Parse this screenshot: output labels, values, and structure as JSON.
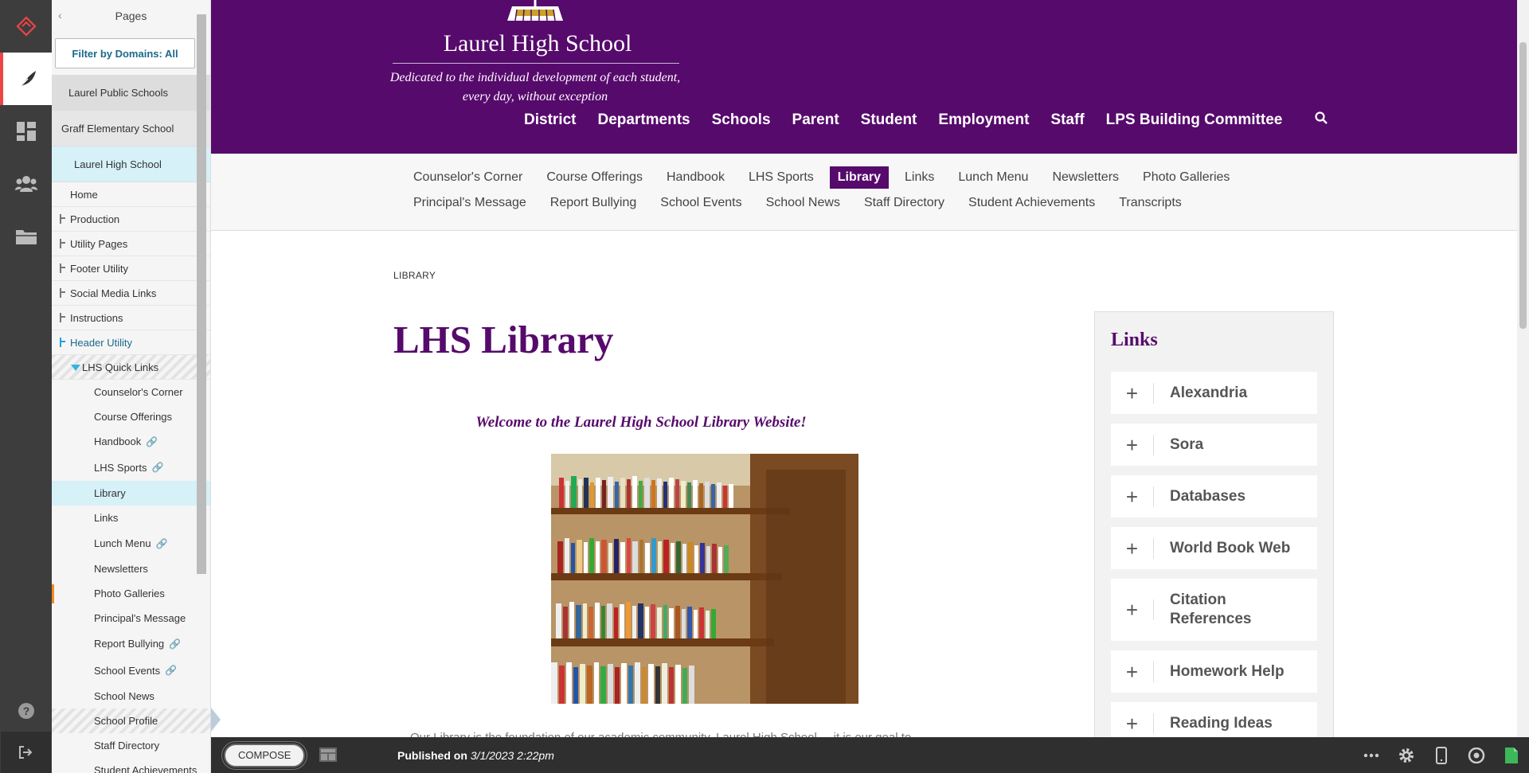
{
  "pages_panel": {
    "title": "Pages",
    "filter": "Filter by Domains: All",
    "domains": [
      "Laurel Public Schools",
      "Graff Elementary School",
      "Laurel High School"
    ],
    "tree_top": [
      {
        "label": "Home"
      },
      {
        "label": "Production"
      },
      {
        "label": "Utility Pages"
      },
      {
        "label": "Footer Utility"
      },
      {
        "label": "Social Media Links"
      },
      {
        "label": "Instructions"
      },
      {
        "label": "Header Utility"
      }
    ],
    "group": "LHS Quick Links",
    "children": [
      {
        "label": "Counselor's Corner"
      },
      {
        "label": "Course Offerings"
      },
      {
        "label": "Handbook"
      },
      {
        "label": "LHS Sports"
      },
      {
        "label": "Library"
      },
      {
        "label": "Links"
      },
      {
        "label": "Lunch Menu"
      },
      {
        "label": "Newsletters"
      },
      {
        "label": "Photo Galleries"
      },
      {
        "label": "Principal's Message"
      },
      {
        "label": "Report Bullying"
      },
      {
        "label": "School Events"
      },
      {
        "label": "School News"
      },
      {
        "label": "School Profile"
      },
      {
        "label": "Staff Directory"
      },
      {
        "label": "Student Achievements"
      }
    ]
  },
  "site": {
    "school_name": "Laurel High School",
    "tagline": "Dedicated to the individual development of each student, every day, without exception",
    "main_nav": [
      "District",
      "Departments",
      "Schools",
      "Parent",
      "Student",
      "Employment",
      "Staff",
      "LPS Building Committee"
    ],
    "sub_nav_row1": [
      "Counselor's Corner",
      "Course Offerings",
      "Handbook",
      "LHS Sports",
      "Library",
      "Links",
      "Lunch Menu",
      "Newsletters",
      "Photo Galleries"
    ],
    "sub_nav_row2": [
      "Principal's Message",
      "Report Bullying",
      "School Events",
      "School News",
      "Staff Directory",
      "Student Achievements",
      "Transcripts"
    ],
    "breadcrumb": "LIBRARY",
    "page_title": "LHS Library",
    "welcome": "Welcome to the Laurel High School Library Website!",
    "cutoff_text": "Our Library is the foundation of our academic community. Laurel High School ... it is our goal to",
    "links_title": "Links",
    "links": [
      "Alexandria",
      "Sora",
      "Databases",
      "World Book Web",
      "Citation References",
      "Homework Help",
      "Reading Ideas"
    ]
  },
  "bottom_bar": {
    "compose": "COMPOSE",
    "published_label": "Published on",
    "published_date": "3/1/2023 2:22pm"
  },
  "colors": {
    "brand_purple": "#560a6c",
    "selected_bg": "#d6f1f7",
    "rail_bg": "#3d3d3d"
  }
}
